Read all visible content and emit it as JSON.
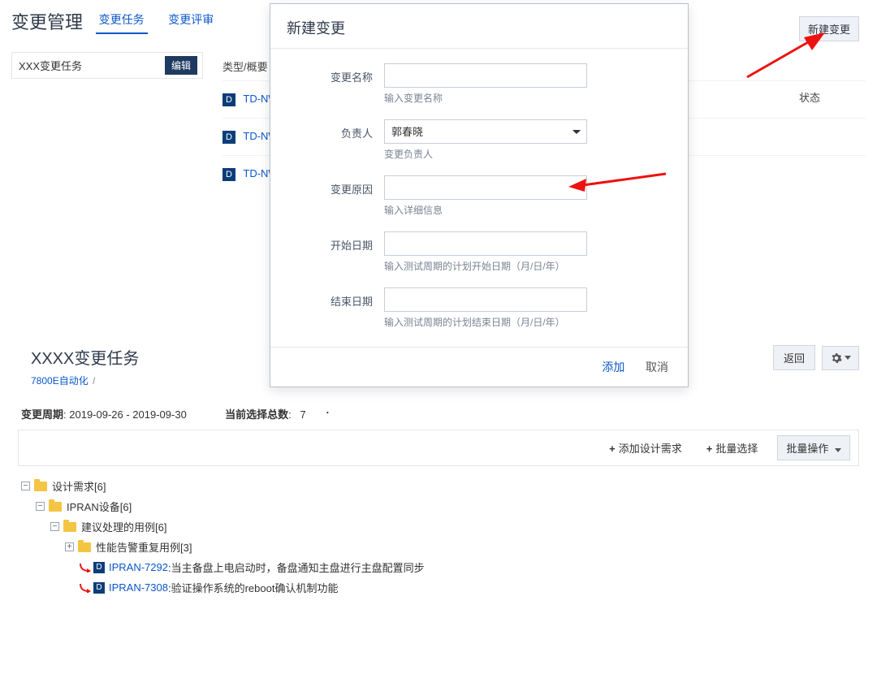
{
  "header": {
    "page_title": "变更管理",
    "tabs": [
      "变更任务",
      "变更评审"
    ],
    "active_tab": 0,
    "new_button": "新建变更"
  },
  "left": {
    "task_name": "XXX变更任务",
    "edit_button": "编辑"
  },
  "list": {
    "col_type": "类型/概要",
    "col_status": "状态",
    "rows": [
      {
        "badge": "D",
        "label": "TD-NW-("
      },
      {
        "badge": "D",
        "label": "TD-NW-("
      },
      {
        "badge": "D",
        "label": "TD-NW-("
      }
    ]
  },
  "modal": {
    "title": "新建变更",
    "fields": {
      "name": {
        "label": "变更名称",
        "hint": "输入变更名称",
        "value": ""
      },
      "owner": {
        "label": "负责人",
        "hint": "变更负责人",
        "value": "郭春晓"
      },
      "reason": {
        "label": "变更原因",
        "hint": "输入详细信息",
        "value": ""
      },
      "start": {
        "label": "开始日期",
        "hint": "输入测试周期的计划开始日期（月/日/年）",
        "value": ""
      },
      "end": {
        "label": "结束日期",
        "hint": "输入测试周期的计划结束日期（月/日/年）",
        "value": ""
      }
    },
    "add": "添加",
    "cancel": "取消"
  },
  "panel": {
    "title": "XXXX变更任务",
    "breadcrumb": "7800E自动化",
    "back": "返回",
    "period_label": "变更周期",
    "period_value": "2019-09-26 - 2019-09-30",
    "selected_label": "当前选择总数",
    "selected_value": "7",
    "toolbar": {
      "add_req": "添加设计需求",
      "batch_select": "批量选择",
      "batch_ops": "批量操作"
    }
  },
  "tree": {
    "n0": {
      "label": "设计需求",
      "count": "[6]"
    },
    "n1": {
      "label": "IPRAN设备",
      "count": "[6]"
    },
    "n2": {
      "label": "建议处理的用例",
      "count": "[6]"
    },
    "n3": {
      "label": "性能告警重复用例",
      "count": "[3]"
    },
    "leaf1": {
      "key": "IPRAN-7292",
      "desc": ":当主备盘上电启动时，备盘通知主盘进行主盘配置同步"
    },
    "leaf2": {
      "key": "IPRAN-7308",
      "desc": ":验证操作系统的reboot确认机制功能"
    }
  },
  "icons": {
    "d_badge": "D",
    "plus": "+",
    "minus": "−",
    "bullet": "·"
  }
}
